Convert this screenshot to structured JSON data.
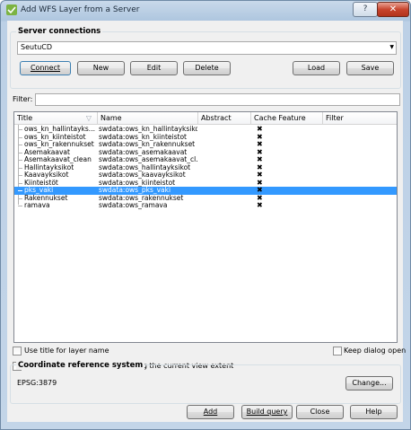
{
  "window": {
    "title": "Add WFS Layer from a Server",
    "help_label": "?",
    "close_label": "✕"
  },
  "server": {
    "group_title": "Server connections",
    "selected": "SeutuCD",
    "buttons": {
      "connect": "Connect",
      "new": "New",
      "edit": "Edit",
      "delete": "Delete",
      "load": "Load",
      "save": "Save"
    }
  },
  "filter": {
    "label": "Filter:",
    "value": ""
  },
  "table": {
    "columns": [
      "Title",
      "Name",
      "Abstract",
      "Cache Feature",
      "Filter"
    ],
    "rows": [
      {
        "title": "ows_kn_hallintayks...",
        "name": "swdata:ows_kn_hallintayksikot",
        "abstract": "",
        "cache": "✖",
        "filter": "",
        "selected": false
      },
      {
        "title": "ows_kn_kiinteistot",
        "name": "swdata:ows_kn_kiinteistot",
        "abstract": "",
        "cache": "✖",
        "filter": "",
        "selected": false
      },
      {
        "title": "ows_kn_rakennukset",
        "name": "swdata:ows_kn_rakennukset",
        "abstract": "",
        "cache": "✖",
        "filter": "",
        "selected": false
      },
      {
        "title": "Asemakaavat",
        "name": "swdata:ows_asemakaavat",
        "abstract": "",
        "cache": "✖",
        "filter": "",
        "selected": false
      },
      {
        "title": "Asemakaavat_clean",
        "name": "swdata:ows_asemakaavat_cl...",
        "abstract": "",
        "cache": "✖",
        "filter": "",
        "selected": false
      },
      {
        "title": "Hallintayksikot",
        "name": "swdata:ows_hallintayksikot",
        "abstract": "",
        "cache": "✖",
        "filter": "",
        "selected": false
      },
      {
        "title": "Kaavayksikot",
        "name": "swdata:ows_kaavayksikot",
        "abstract": "",
        "cache": "✖",
        "filter": "",
        "selected": false
      },
      {
        "title": "Kiinteistöt",
        "name": "swdata:ows_kiinteistot",
        "abstract": "",
        "cache": "✖",
        "filter": "",
        "selected": false
      },
      {
        "title": "pks_vaki",
        "name": "swdata:ows_pks_vaki",
        "abstract": "",
        "cache": "✖",
        "filter": "",
        "selected": true
      },
      {
        "title": "Rakennukset",
        "name": "swdata:ows_rakennukset",
        "abstract": "",
        "cache": "✖",
        "filter": "",
        "selected": false
      },
      {
        "title": "ramava",
        "name": "swdata:ows_ramava",
        "abstract": "",
        "cache": "✖",
        "filter": "",
        "selected": false
      }
    ]
  },
  "options": {
    "use_title": "Use title for layer name",
    "keep_open": "Keep dialog open",
    "overlap": "Only request features overlapping the current view extent"
  },
  "crs": {
    "group_title": "Coordinate reference system",
    "value": "EPSG:3879",
    "change_label": "Change..."
  },
  "footer": {
    "add": "Add",
    "build_query": "Build query",
    "close": "Close",
    "help": "Help"
  }
}
